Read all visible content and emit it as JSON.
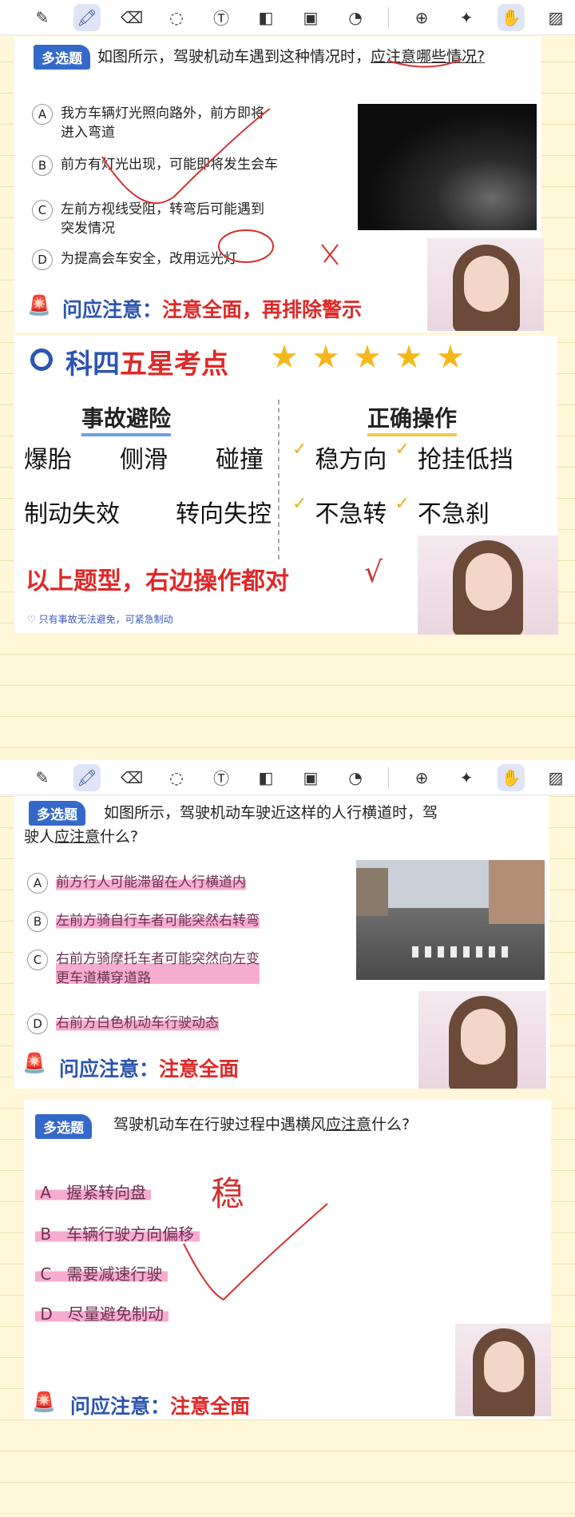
{
  "toolbar": {
    "tools": [
      {
        "name": "pen-icon",
        "glyph": "✎"
      },
      {
        "name": "highlighter-icon",
        "glyph": "🖍"
      },
      {
        "name": "eraser-icon",
        "glyph": "⌫"
      },
      {
        "name": "lasso-icon",
        "glyph": "◌"
      },
      {
        "name": "text-tool-icon",
        "glyph": "Ⓣ"
      },
      {
        "name": "shapes-icon",
        "glyph": "◧"
      },
      {
        "name": "image-icon",
        "glyph": "▣"
      },
      {
        "name": "sticker-icon",
        "glyph": "◔"
      },
      {
        "name": "zoom-icon",
        "glyph": "⊕"
      },
      {
        "name": "laser-pointer-icon",
        "glyph": "✦"
      },
      {
        "name": "hand-touch-icon",
        "glyph": "✋"
      },
      {
        "name": "pattern-icon",
        "glyph": "▨"
      }
    ]
  },
  "q1": {
    "badge": "多选题",
    "question": "如图所示，驾驶机动车遇到这种情况时，",
    "question_u": "应注意哪些情况?",
    "options": [
      {
        "letter": "A",
        "text": "我方车辆灯光照向路外，前方即将\n进入弯道"
      },
      {
        "letter": "B",
        "text": "前方有灯光出现，可能即将发生会车"
      },
      {
        "letter": "C",
        "text": "左前方视线受阻，转弯后可能遇到\n突发情况"
      },
      {
        "letter": "D",
        "text": "为提高会车安全，改用远光灯"
      }
    ],
    "ask": "问应注意：",
    "ask_red": "注意全面，再排除警示"
  },
  "points": {
    "title_blue": "科四",
    "title_red": "五星考点",
    "left_head": "事故避险",
    "right_head": "正确操作",
    "left_row1": [
      "爆胎",
      "侧滑",
      "碰撞"
    ],
    "left_row2": [
      "制动失效",
      "转向失控"
    ],
    "right_row1": [
      "稳方向",
      "抢挂低挡"
    ],
    "right_row2": [
      "不急转",
      "不急刹"
    ],
    "summary": "以上题型，右边操作都对",
    "note": "只有事故无法避免，可紧急制动"
  },
  "q2": {
    "badge": "多选题",
    "question_pre": "如图所示，驾驶机动车驶近这样的人行横道时，驾",
    "question_line2_pre": "驶人",
    "question_u": "应注意",
    "question_post": "什么?",
    "options": [
      {
        "letter": "A",
        "text": "前方行人可能滞留在人行横道内"
      },
      {
        "letter": "B",
        "text": "左前方骑自行车者可能突然右转弯"
      },
      {
        "letter": "C",
        "text": "右前方骑摩托车者可能突然向左变\n更车道横穿道路"
      },
      {
        "letter": "D",
        "text": "右前方白色机动车行驶动态"
      }
    ],
    "ask": "问应注意：",
    "ask_red": "注意全面"
  },
  "q3": {
    "badge": "多选题",
    "question_pre": "驾驶机动车在行驶过程中遇横风",
    "question_u": "应注意",
    "question_post": "什么?",
    "options": [
      {
        "letter": "A",
        "text": "握紧转向盘"
      },
      {
        "letter": "B",
        "text": "车辆行驶方向偏移"
      },
      {
        "letter": "C",
        "text": "需要减速行驶"
      },
      {
        "letter": "D",
        "text": "尽量避免制动"
      }
    ],
    "ask": "问应注意：",
    "ask_red": "注意全面",
    "handwriting": "稳"
  }
}
